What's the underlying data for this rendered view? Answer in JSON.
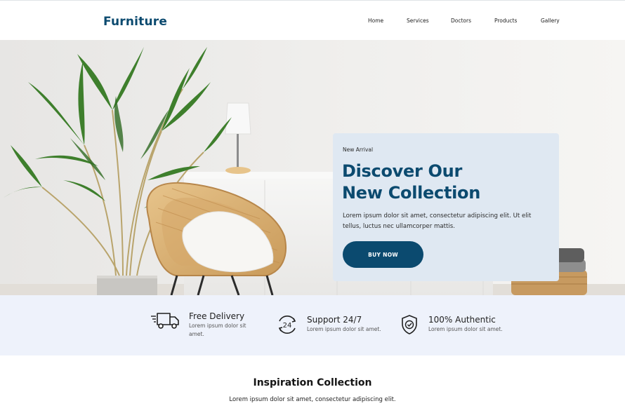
{
  "header": {
    "logo": "Furniture",
    "nav": [
      {
        "label": "Home"
      },
      {
        "label": "Services"
      },
      {
        "label": "Doctors"
      },
      {
        "label": "Products"
      },
      {
        "label": "Gallery"
      }
    ]
  },
  "hero": {
    "eyebrow": "New Arrival",
    "title_line1": "Discover Our",
    "title_line2": "New Collection",
    "text": "Lorem ipsum dolor sit amet, consectetur adipiscing elit. Ut elit tellus, luctus nec ullamcorper mattis.",
    "button": "BUY NOW",
    "image": "living-room-photo with palm plant, rattan chair, white sideboard, lamp, basket"
  },
  "features": [
    {
      "icon": "delivery-truck-icon",
      "title": "Free Delivery",
      "desc": "Lorem ipsum dolor sit amet."
    },
    {
      "icon": "support-24-7-icon",
      "title": "Support 24/7",
      "desc": "Lorem ipsum dolor sit amet."
    },
    {
      "icon": "shield-check-icon",
      "title": "100% Authentic",
      "desc": "Lorem ipsum dolor sit amet."
    }
  ],
  "inspiration": {
    "title": "Inspiration Collection",
    "subtitle": "Lorem ipsum dolor sit amet, consectetur adipiscing elit."
  },
  "colors": {
    "brand": "#0b4a6f",
    "card_bg": "#dfe8f2",
    "features_bg": "#eef2fb"
  }
}
